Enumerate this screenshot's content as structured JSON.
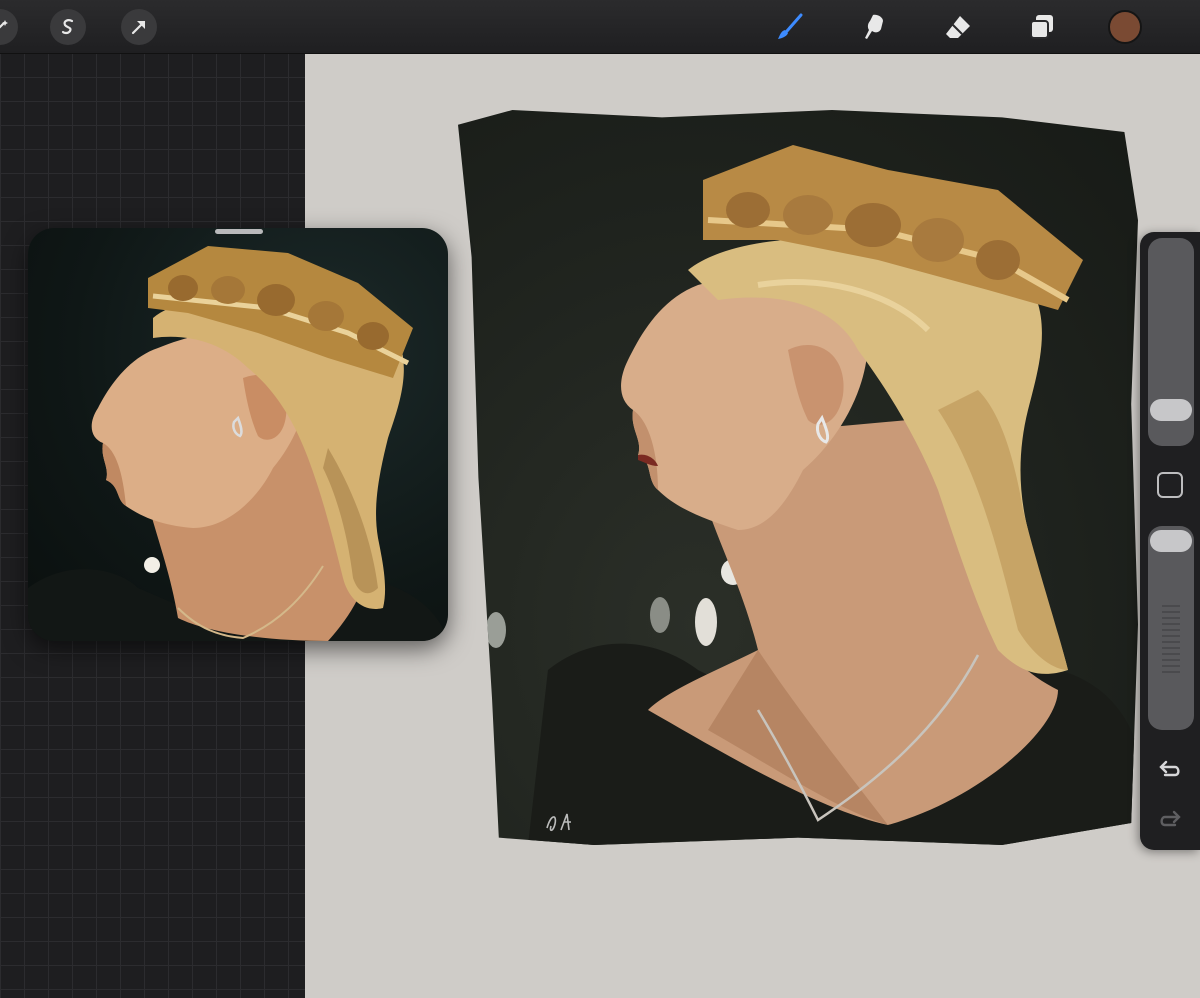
{
  "toolbar": {
    "left_buttons": [
      {
        "icon": "wand-icon"
      },
      {
        "icon": "selection-s-icon"
      },
      {
        "icon": "transform-arrow-icon"
      }
    ],
    "tools": [
      {
        "icon": "brush-icon",
        "active": true
      },
      {
        "icon": "smudge-icon"
      },
      {
        "icon": "eraser-icon"
      },
      {
        "icon": "layers-icon"
      }
    ],
    "current_color": "#7a4a33",
    "accent_color": "#3d8bff"
  },
  "sidebar": {
    "brush_size_slider": {
      "value": 0.12
    },
    "opacity_slider": {
      "value": 1.0
    },
    "modify_button": {
      "icon": "square-icon"
    },
    "undo": {
      "icon": "undo-icon"
    },
    "redo": {
      "icon": "redo-icon"
    }
  },
  "reference_window": {
    "icon": "drag-handle-icon"
  },
  "canvas": {
    "background": "#cfccc8",
    "painting_background": "#1e221d"
  }
}
